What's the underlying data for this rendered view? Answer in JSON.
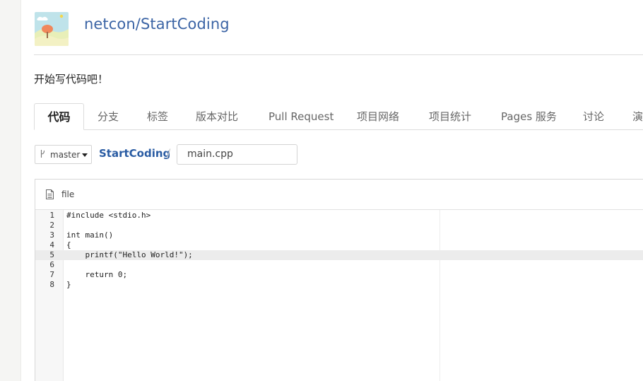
{
  "repo": {
    "owner": "netcon",
    "name": "StartCoding",
    "separator": "/",
    "description": "开始写代码吧！"
  },
  "tabs": [
    {
      "label": "代码",
      "active": true
    },
    {
      "label": "分支",
      "active": false
    },
    {
      "label": "标签",
      "active": false
    },
    {
      "label": "版本对比",
      "active": false
    },
    {
      "label": "Pull Request",
      "active": false
    },
    {
      "label": "项目网络",
      "active": false
    },
    {
      "label": "项目统计",
      "active": false
    },
    {
      "label": "Pages 服务",
      "active": false
    },
    {
      "label": "讨论",
      "active": false
    },
    {
      "label": "演",
      "active": false
    }
  ],
  "branch": {
    "label": "master",
    "icon": "branch-icon"
  },
  "breadcrumb": {
    "root": "StartCoding",
    "separator": "/",
    "filename": "main.cpp"
  },
  "file": {
    "label": "file",
    "icon": "file-icon"
  },
  "code": {
    "highlighted_line": 5,
    "lines": [
      "#include <stdio.h>",
      "",
      "int main()",
      "{",
      "    printf(\"Hello World!\");",
      "",
      "    return 0;",
      "}"
    ]
  },
  "colors": {
    "link": "#3b64a5",
    "breadcrumb": "#2a5ca3",
    "highlight_line": "#ececec"
  }
}
